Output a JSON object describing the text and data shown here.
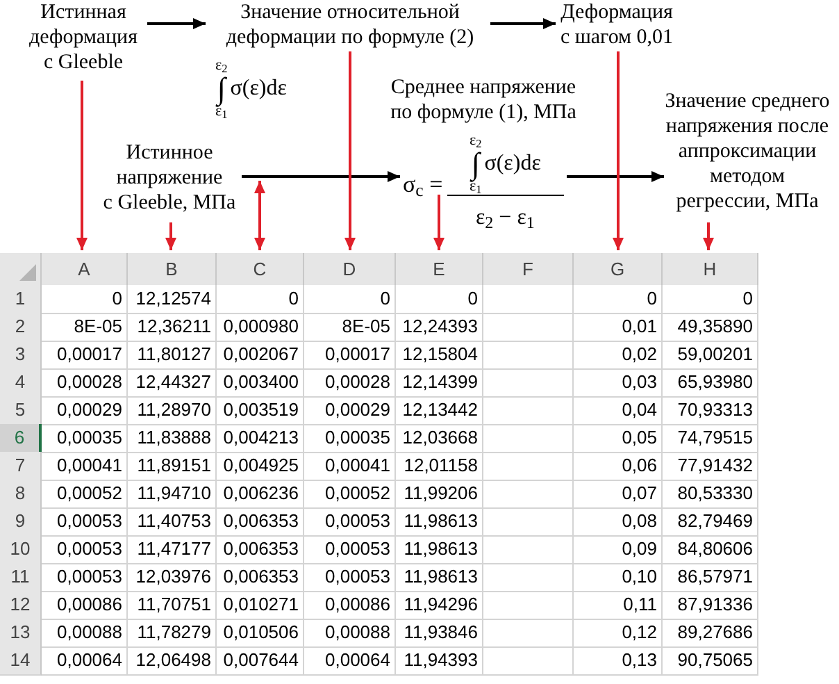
{
  "annotations": [
    {
      "kind": "label",
      "text": "Истинная\nдеформация\nс Gleeble"
    },
    {
      "kind": "label",
      "text": "Значение относительной\nдеформации по формуле (2)"
    },
    {
      "kind": "label",
      "text": "Деформация\nс шагом 0,01"
    },
    {
      "kind": "label",
      "text": "Среднее напряжение\nпо формуле (1), МПа"
    },
    {
      "kind": "label",
      "text": "Истинное\nнапряжение\nс Gleeble, МПа"
    },
    {
      "kind": "label",
      "text": "Значение среднего\nнапряжения после\nаппроксимации\nметодом\nрегрессии, МПа"
    }
  ],
  "formula_integral": {
    "sign": "∫",
    "upper": "ε$_{2}$",
    "lower": "ε$_{1}$",
    "integrand": "σ(ε)dε"
  },
  "formula_mean": {
    "lhs": "σ$_{c}$ =",
    "numerator": {
      "sign": "∫",
      "upper": "ε$_{2}$",
      "lower": "ε$_{1}$",
      "integrand": "σ(ε)dε"
    },
    "denominator": "ε$_{2}$ − ε$_{1}$"
  },
  "spreadsheet": {
    "columns": [
      "A",
      "B",
      "C",
      "D",
      "E",
      "F",
      "G",
      "H"
    ],
    "rows": [
      {
        "number": "1",
        "selected": false,
        "cells": [
          "0",
          "12,12574",
          "0",
          "0",
          "0",
          null,
          "0",
          "0"
        ]
      },
      {
        "number": "2",
        "selected": false,
        "cells": [
          "8E-05",
          "12,36211",
          "0,000980",
          "8E-05",
          "12,24393",
          null,
          "0,01",
          "49,35890"
        ]
      },
      {
        "number": "3",
        "selected": false,
        "cells": [
          "0,00017",
          "11,80127",
          "0,002067",
          "0,00017",
          "12,15804",
          null,
          "0,02",
          "59,00201"
        ]
      },
      {
        "number": "4",
        "selected": false,
        "cells": [
          "0,00028",
          "12,44327",
          "0,003400",
          "0,00028",
          "12,14399",
          null,
          "0,03",
          "65,93980"
        ]
      },
      {
        "number": "5",
        "selected": false,
        "cells": [
          "0,00029",
          "11,28970",
          "0,003519",
          "0,00029",
          "12,13442",
          null,
          "0,04",
          "70,93313"
        ]
      },
      {
        "number": "6",
        "selected": true,
        "cells": [
          "0,00035",
          "11,83888",
          "0,004213",
          "0,00035",
          "12,03668",
          null,
          "0,05",
          "74,79515"
        ]
      },
      {
        "number": "7",
        "selected": false,
        "cells": [
          "0,00041",
          "11,89151",
          "0,004925",
          "0,00041",
          "12,01158",
          null,
          "0,06",
          "77,91432"
        ]
      },
      {
        "number": "8",
        "selected": false,
        "cells": [
          "0,00052",
          "11,94710",
          "0,006236",
          "0,00052",
          "11,99206",
          null,
          "0,07",
          "80,53330"
        ]
      },
      {
        "number": "9",
        "selected": false,
        "cells": [
          "0,00053",
          "11,40753",
          "0,006353",
          "0,00053",
          "11,98613",
          null,
          "0,08",
          "82,79469"
        ]
      },
      {
        "number": "10",
        "selected": false,
        "cells": [
          "0,00053",
          "11,47177",
          "0,006353",
          "0,00053",
          "11,98613",
          null,
          "0,09",
          "84,80606"
        ]
      },
      {
        "number": "11",
        "selected": false,
        "cells": [
          "0,00053",
          "12,03976",
          "0,006353",
          "0,00053",
          "11,98613",
          null,
          "0,10",
          "86,57971"
        ]
      },
      {
        "number": "12",
        "selected": false,
        "cells": [
          "0,00086",
          "11,70751",
          "0,010271",
          "0,00086",
          "11,94296",
          null,
          "0,11",
          "87,91336"
        ]
      },
      {
        "number": "13",
        "selected": false,
        "cells": [
          "0,00088",
          "11,78279",
          "0,010506",
          "0,00088",
          "11,93846",
          null,
          "0,12",
          "89,27686"
        ]
      },
      {
        "number": "14",
        "selected": false,
        "cells": [
          "0,00064",
          "12,06498",
          "0,007644",
          "0,00064",
          "11,94393",
          null,
          "0,13",
          "90,75065"
        ]
      }
    ]
  }
}
